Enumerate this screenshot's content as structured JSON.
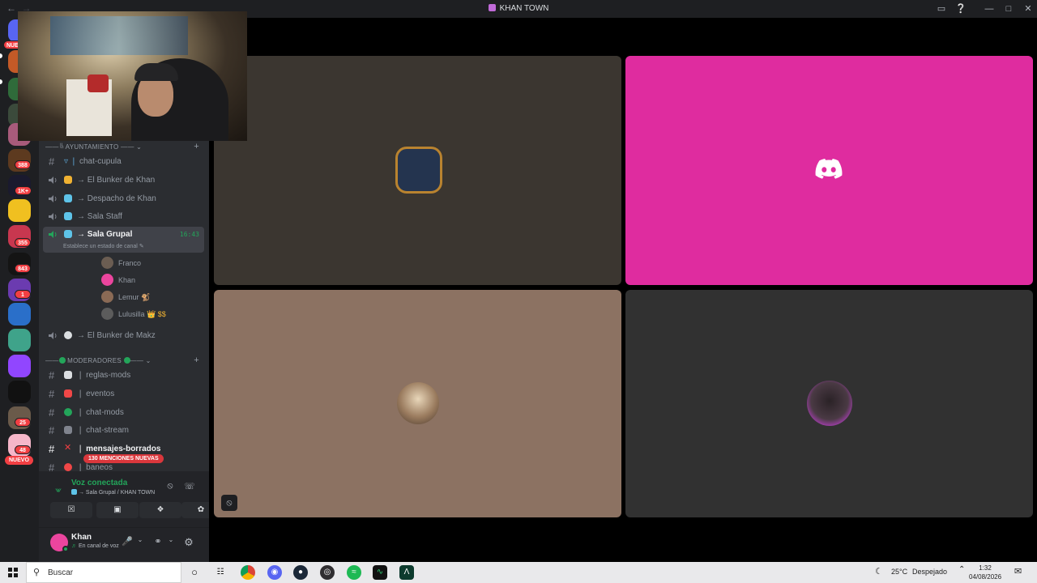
{
  "window": {
    "title": "KHAN TOWN"
  },
  "rail": {
    "badges": [
      "NUE",
      "388",
      "1K+",
      "355",
      "843",
      "1",
      "25",
      "48"
    ],
    "new_pill": "NUEVO"
  },
  "sidebar": {
    "category1": "AYUNTAMIENTO",
    "category1_emoji": "╚",
    "channels1": [
      {
        "type": "text",
        "name": "chat-cupula",
        "prefix": "▿ ❘"
      },
      {
        "type": "voice",
        "name": "→ El Bunker de Khan"
      },
      {
        "type": "voice",
        "name": "→ Despacho de Khan"
      },
      {
        "type": "voice",
        "name": "→ Sala Staff"
      },
      {
        "type": "voice",
        "name": "→ Sala Grupal",
        "timer": "16:43"
      },
      {
        "type": "voice",
        "name": "→ El Bunker de Makz"
      }
    ],
    "channel_status": "Establece un estado de canal",
    "voice_users": [
      "Franco",
      "Khan",
      "Lemur",
      "Lulusilla"
    ],
    "lemur_suffix": "🐒",
    "lulusilla_suffix": "👑 $$",
    "category2": "MODERADORES",
    "channels2": [
      "reglas-mods",
      "eventos",
      "chat-mods",
      "chat-stream",
      "mensajes-borrados",
      "baneos"
    ],
    "mentions_pill": "130 MENCIONES NUEVAS"
  },
  "voice_panel": {
    "status": "Voz conectada",
    "location": "→ Sala Grupal / KHAN TOWN"
  },
  "user_panel": {
    "username": "Khan",
    "status": "En canal de voz"
  },
  "stage": {
    "tile_colors": [
      "#3b3630",
      "#df2c9f",
      "#8c7262",
      "#313131"
    ]
  },
  "taskbar": {
    "search_placeholder": "Buscar",
    "temperature": "25°C",
    "weather": "Despejado",
    "time": "1:32",
    "date": "04/08/2026"
  }
}
